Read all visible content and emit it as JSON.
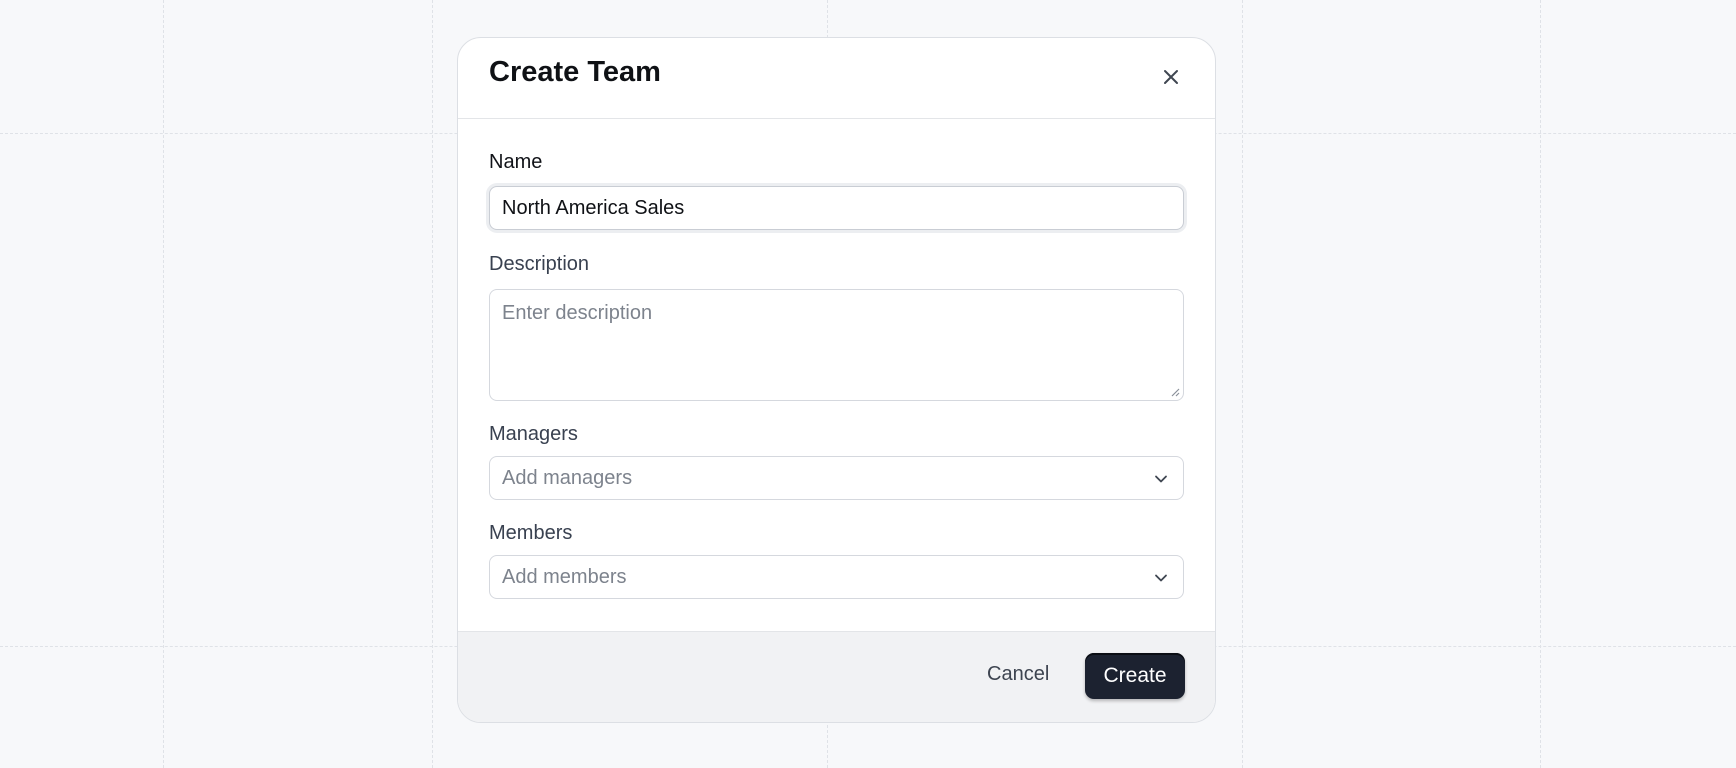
{
  "modal": {
    "title": "Create Team",
    "close_icon": "close-icon"
  },
  "form": {
    "name": {
      "label": "Name",
      "value": "North America Sales"
    },
    "description": {
      "label": "Description",
      "placeholder": "Enter description",
      "value": ""
    },
    "managers": {
      "label": "Managers",
      "placeholder": "Add managers",
      "icon": "chevron-down-icon"
    },
    "members": {
      "label": "Members",
      "placeholder": "Add members",
      "icon": "chevron-down-icon"
    }
  },
  "footer": {
    "cancel_label": "Cancel",
    "create_label": "Create"
  },
  "colors": {
    "background": "#f7f8fa",
    "primary_button": "#1c2230",
    "footer_bg": "#f1f2f4"
  }
}
